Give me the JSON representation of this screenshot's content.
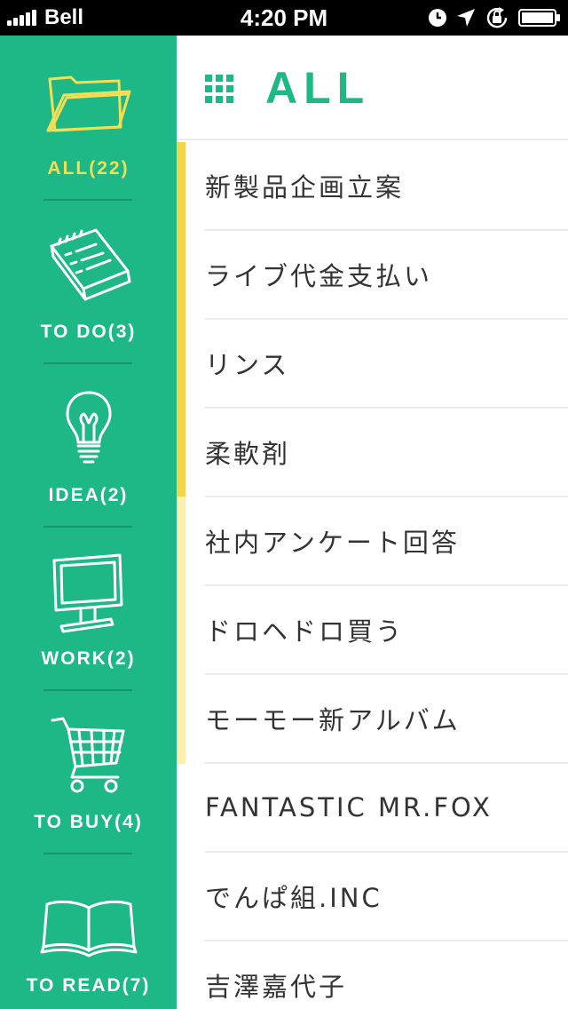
{
  "status_bar": {
    "carrier": "Bell",
    "time": "4:20 PM"
  },
  "sidebar": {
    "categories": [
      {
        "label": "ALL(22)",
        "icon": "folder-icon",
        "active": true
      },
      {
        "label": "TO DO(3)",
        "icon": "notepad-icon",
        "active": false
      },
      {
        "label": "IDEA(2)",
        "icon": "lightbulb-icon",
        "active": false
      },
      {
        "label": "WORK(2)",
        "icon": "computer-icon",
        "active": false
      },
      {
        "label": "TO BUY(4)",
        "icon": "shopping-cart-icon",
        "active": false
      },
      {
        "label": "TO READ(7)",
        "icon": "book-icon",
        "active": false
      }
    ]
  },
  "header": {
    "title": "ALL"
  },
  "list": {
    "items": [
      "新製品企画立案",
      "ライブ代金支払い",
      "リンス",
      "柔軟剤",
      "社内アンケート回答",
      "ドロヘドロ買う",
      "モーモー新アルバム",
      "FANTASTIC MR.FOX",
      "でんぱ組.INC",
      "吉澤嘉代子"
    ]
  },
  "scroll": {
    "visible_fraction": 0.57
  },
  "colors": {
    "brand_green": "#1db885",
    "active_yellow": "#f2df55",
    "scroll_thumb": "#f2d54a",
    "scroll_track": "#fbeeb0",
    "text": "#333333"
  }
}
